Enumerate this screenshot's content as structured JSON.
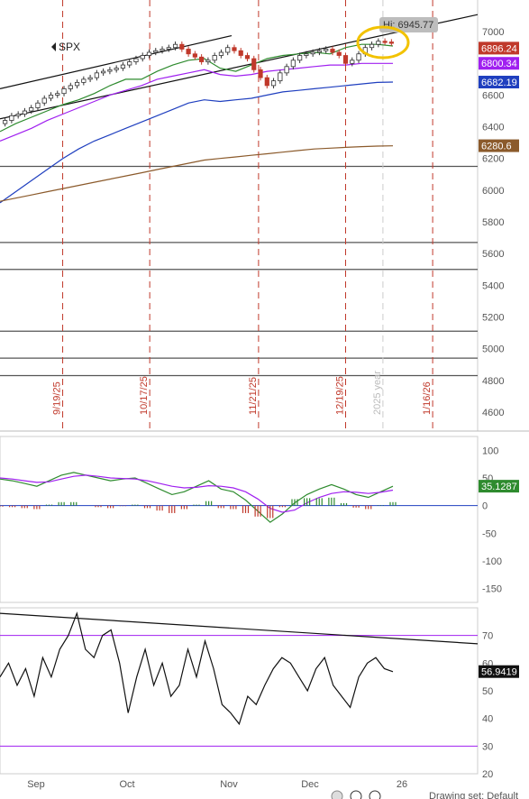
{
  "symbol_label": "SPX",
  "hi_label": "Hi: 6945.77",
  "footer_label": "Drawing set: Default",
  "colors": {
    "up": "#ffffff",
    "down": "#c0392b",
    "ma_green": "#2e8b2e",
    "ma_purple": "#a020f0",
    "ma_blue": "#1f3fbf",
    "ma_brown": "#8b5a2b",
    "highlight": "#f2c200",
    "vline": "#c0392b"
  },
  "chart_data": [
    {
      "type": "line",
      "title": "SPX",
      "ylim": [
        4480,
        7200
      ],
      "y_ticks": [
        "7000",
        "6800",
        "6600",
        "6400",
        "6200",
        "6000",
        "5800",
        "5600",
        "5400",
        "5200",
        "5000",
        "4800",
        "4600"
      ],
      "price_tags": [
        {
          "label": "6896.24",
          "value": 6896.24,
          "color": "#c0392b",
          "text": "#ffffff"
        },
        {
          "label": "6800.34",
          "value": 6800.34,
          "color": "#a020f0",
          "text": "#ffffff"
        },
        {
          "label": "6682.19",
          "value": 6682.19,
          "color": "#1f3fbf",
          "text": "#ffffff"
        },
        {
          "label": "6280.6",
          "value": 6280.6,
          "color": "#8b5a2b",
          "text": "#ffffff"
        }
      ],
      "x_month_labels": [
        "Sep",
        "Oct",
        "Nov",
        "Dec",
        "26"
      ],
      "vertical_date_labels": [
        {
          "label": "9/19/25",
          "day": 19
        },
        {
          "label": "10/17/25",
          "day": 47
        },
        {
          "label": "11/21/25",
          "day": 82
        },
        {
          "label": "12/19/25",
          "day": 110
        },
        {
          "label": "1/16/26",
          "day": 138
        }
      ],
      "year_marker": {
        "label": "2025 year",
        "day": 122
      },
      "horizontal_levels": [
        6150,
        5670,
        5500,
        5110,
        4940,
        4830
      ],
      "series": [
        {
          "name": "",
          "style": "ma_green",
          "values": [
            6370,
            6420,
            6460,
            6500,
            6540,
            6570,
            6610,
            6660,
            6700,
            6700,
            6750,
            6790,
            6820,
            6830,
            6770,
            6750,
            6790,
            6830,
            6850,
            6860,
            6870,
            6860,
            6900,
            6920,
            6920,
            6910
          ]
        },
        {
          "name": "",
          "style": "ma_purple",
          "values": [
            6310,
            6350,
            6390,
            6440,
            6480,
            6520,
            6560,
            6600,
            6630,
            6660,
            6700,
            6720,
            6740,
            6760,
            6730,
            6720,
            6730,
            6750,
            6760,
            6770,
            6780,
            6790,
            6790,
            6800,
            6800,
            6800
          ]
        },
        {
          "name": "",
          "style": "ma_blue",
          "values": [
            5920,
            5990,
            6060,
            6130,
            6200,
            6260,
            6310,
            6350,
            6390,
            6430,
            6470,
            6510,
            6550,
            6570,
            6560,
            6570,
            6580,
            6600,
            6620,
            6630,
            6640,
            6650,
            6660,
            6670,
            6680,
            6682
          ]
        },
        {
          "name": "",
          "style": "ma_brown",
          "values": [
            5930,
            5950,
            5970,
            5990,
            6010,
            6030,
            6050,
            6070,
            6090,
            6110,
            6130,
            6150,
            6170,
            6190,
            6200,
            6210,
            6220,
            6230,
            6240,
            6250,
            6260,
            6265,
            6270,
            6275,
            6278,
            6280
          ]
        }
      ],
      "candle_closes": [
        6440,
        6470,
        6480,
        6500,
        6520,
        6550,
        6580,
        6600,
        6610,
        6640,
        6660,
        6680,
        6700,
        6710,
        6740,
        6750,
        6760,
        6770,
        6790,
        6810,
        6830,
        6850,
        6870,
        6880,
        6890,
        6900,
        6920,
        6890,
        6860,
        6840,
        6810,
        6820,
        6850,
        6870,
        6900,
        6880,
        6850,
        6830,
        6760,
        6710,
        6660,
        6690,
        6740,
        6780,
        6820,
        6850,
        6860,
        6870,
        6880,
        6890,
        6870,
        6850,
        6800,
        6820,
        6860,
        6900,
        6920,
        6940,
        6935,
        6930
      ]
    },
    {
      "type": "line",
      "title": "",
      "ylim": [
        -175,
        125
      ],
      "y_ticks": [
        "100",
        "50",
        "0",
        "-50",
        "-100",
        "-150"
      ],
      "value_tag": "35.1287",
      "series": [
        {
          "name": "",
          "style": "green",
          "values": [
            48,
            45,
            40,
            35,
            45,
            55,
            60,
            55,
            50,
            45,
            48,
            50,
            40,
            30,
            20,
            25,
            35,
            45,
            30,
            25,
            10,
            -10,
            -30,
            -15,
            5,
            20,
            30,
            38,
            30,
            20,
            15,
            25,
            35
          ]
        },
        {
          "name": "",
          "style": "purple",
          "values": [
            50,
            48,
            45,
            42,
            43,
            48,
            53,
            55,
            53,
            50,
            49,
            48,
            45,
            40,
            35,
            32,
            33,
            36,
            35,
            32,
            25,
            12,
            -5,
            -12,
            -8,
            5,
            15,
            22,
            25,
            24,
            22,
            24,
            28
          ]
        },
        {
          "name": "",
          "style": "hist",
          "values": [
            -2,
            -3,
            -5,
            -7,
            2,
            7,
            7,
            0,
            -3,
            -5,
            -1,
            2,
            -5,
            -10,
            -15,
            -7,
            2,
            9,
            -5,
            -7,
            -15,
            -22,
            -25,
            -3,
            13,
            15,
            15,
            16,
            5,
            -4,
            -7,
            1,
            7
          ]
        }
      ]
    },
    {
      "type": "line",
      "title": "",
      "ylim": [
        20,
        80
      ],
      "y_ticks": [
        "70",
        "60",
        "50",
        "40",
        "30",
        "20"
      ],
      "value_tag": "56.9419",
      "reference_lines": [
        70,
        30
      ],
      "trendline": {
        "from": [
          0,
          78
        ],
        "to": [
          1,
          67
        ]
      },
      "series": [
        {
          "name": "",
          "style": "black",
          "values": [
            55,
            60,
            52,
            58,
            48,
            62,
            55,
            65,
            70,
            78,
            65,
            62,
            70,
            72,
            60,
            42,
            55,
            65,
            52,
            60,
            48,
            52,
            65,
            55,
            68,
            58,
            45,
            42,
            38,
            48,
            45,
            52,
            58,
            62,
            60,
            55,
            50,
            58,
            62,
            52,
            48,
            44,
            55,
            60,
            62,
            58,
            56.9
          ]
        }
      ]
    }
  ]
}
